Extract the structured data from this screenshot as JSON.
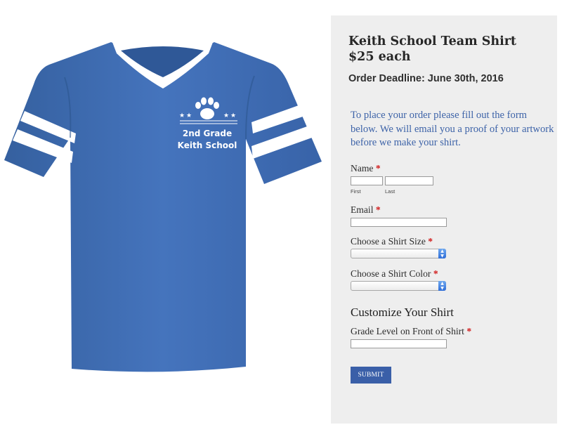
{
  "product": {
    "title": "Keith School Team Shirt",
    "price": "$25 each",
    "deadline": "Order Deadline: June 30th, 2016",
    "intro": "To place your order please fill out the form below. We will email you a proof of your artwork before we make your shirt."
  },
  "shirt_print": {
    "line1": "2nd Grade",
    "line2": "Keith School"
  },
  "form": {
    "required_mark": "*",
    "name": {
      "label": "Name",
      "first_sublabel": "First",
      "last_sublabel": "Last",
      "first_value": "",
      "last_value": ""
    },
    "email": {
      "label": "Email",
      "value": ""
    },
    "size": {
      "label": "Choose a Shirt Size",
      "selected": ""
    },
    "color": {
      "label": "Choose a Shirt Color",
      "selected": ""
    },
    "customize_heading": "Customize Your Shirt",
    "grade": {
      "label": "Grade Level on Front of Shirt",
      "value": ""
    },
    "submit_label": "SUBMIT"
  },
  "colors": {
    "shirt_blue": "#3f6db6",
    "panel_bg": "#eeeeee",
    "intro_text": "#3d63a8",
    "submit_bg": "#3a5fa8",
    "required": "#d11a1a"
  }
}
